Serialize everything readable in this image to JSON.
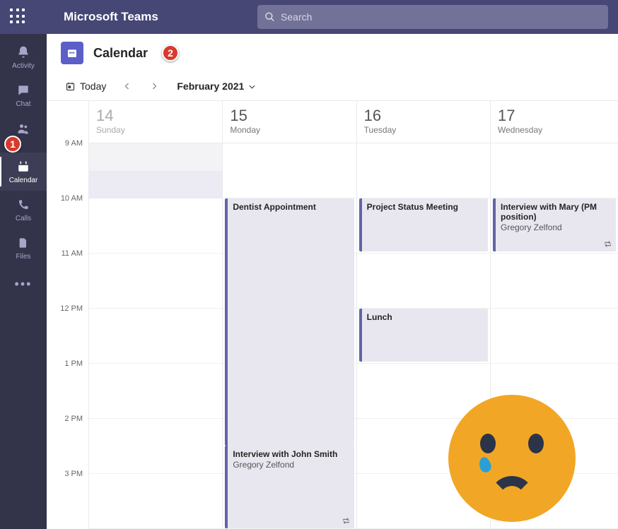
{
  "brand": "Microsoft Teams",
  "search": {
    "placeholder": "Search"
  },
  "rail": {
    "items": [
      {
        "id": "activity",
        "label": "Activity"
      },
      {
        "id": "chat",
        "label": "Chat"
      },
      {
        "id": "teams",
        "label": "Teams"
      },
      {
        "id": "calendar",
        "label": "Calendar"
      },
      {
        "id": "calls",
        "label": "Calls"
      },
      {
        "id": "files",
        "label": "Files"
      }
    ],
    "active": "calendar"
  },
  "annotations": {
    "badge1": "1",
    "badge2": "2"
  },
  "header": {
    "title": "Calendar"
  },
  "toolbar": {
    "today": "Today",
    "month": "February 2021"
  },
  "time_labels": [
    "9 AM",
    "10 AM",
    "11 AM",
    "12 PM",
    "1 PM",
    "2 PM",
    "3 PM"
  ],
  "days": [
    {
      "num": "14",
      "name": "Sunday",
      "dim": true
    },
    {
      "num": "15",
      "name": "Monday",
      "dim": false
    },
    {
      "num": "16",
      "name": "Tuesday",
      "dim": false
    },
    {
      "num": "17",
      "name": "Wednesday",
      "dim": false
    }
  ],
  "events": {
    "e1": {
      "title": "Dentist Appointment"
    },
    "e2": {
      "title": "Interview with John Smith",
      "sub": "Gregory Zelfond"
    },
    "e3": {
      "title": "Project Status Meeting"
    },
    "e4": {
      "title": "Lunch"
    },
    "e5": {
      "title": "Interview with Mary (PM position)",
      "sub": "Gregory Zelfond"
    }
  }
}
